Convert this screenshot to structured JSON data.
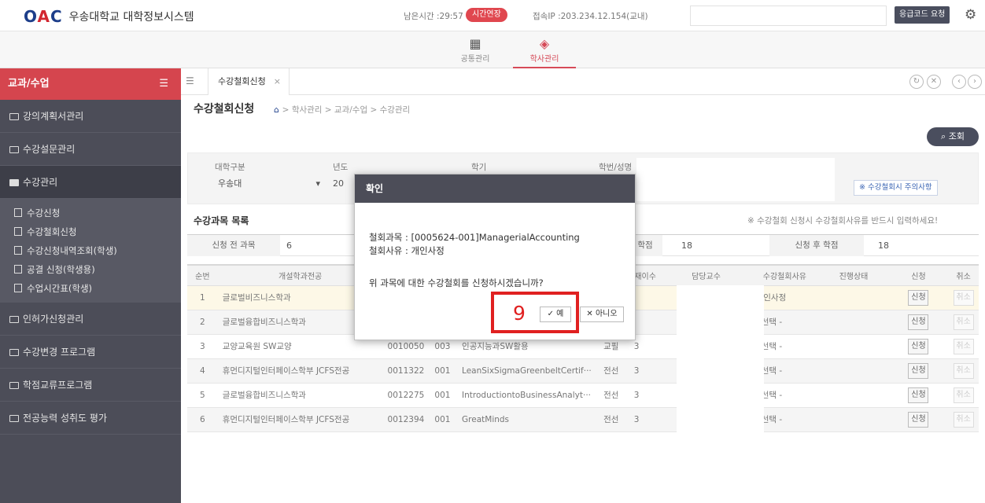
{
  "header": {
    "logo_mark": "OAC",
    "logo_text": "우송대학교 대학정보시스템",
    "remaining_time": "남은시간 :29:57",
    "extend_label": "시간연장",
    "ip_info": "접속IP :203.234.12.154(교내)",
    "emergency_code_label": "응급코드 요청",
    "settings_icon": "gear-icon"
  },
  "modules": [
    {
      "label": "공통관리",
      "icon": "grid-icon"
    },
    {
      "label": "학사관리",
      "icon": "graduation-cap-icon"
    }
  ],
  "sidebar": {
    "title": "교과/수업",
    "items": [
      {
        "label": "강의계획서관리"
      },
      {
        "label": "수강설문관리"
      },
      {
        "label": "수강관리"
      }
    ],
    "subitems": [
      {
        "label": "수강신청"
      },
      {
        "label": "수강철회신청"
      },
      {
        "label": "수강신청내역조회(학생)"
      },
      {
        "label": "공결 신청(학생용)"
      },
      {
        "label": "수업시간표(학생)"
      }
    ],
    "more_items": [
      {
        "label": "인허가신청관리"
      },
      {
        "label": "수강변경 프로그램"
      },
      {
        "label": "학점교류프로그램"
      },
      {
        "label": "전공능력 성취도 평가"
      }
    ]
  },
  "tabs": {
    "active_tab": "수강철회신청"
  },
  "page": {
    "title": "수강철회신청",
    "breadcrumb": "학사관리 > 교과/수업 > 수강관리",
    "search_label": "조회"
  },
  "filter": {
    "univ_label": "대학구분",
    "univ_value": "우송대",
    "year_label": "년도",
    "year_value": "20",
    "semester_label": "학기",
    "student_label": "학번/성명",
    "notice_label": "※ 수강철회시 주의사항"
  },
  "list": {
    "title": "수강과목 목록",
    "note": "※ 수강철회 신청시 수강철회사유를 반드시 입력하세요!",
    "summary": {
      "before_label": "신청 전 과목",
      "before_value": "6",
      "credit_label": "학점",
      "credit_value": "18",
      "after_label": "신청 후 학점",
      "after_value": "18"
    },
    "columns": [
      "순번",
      "개설학과전공",
      "",
      "",
      "",
      "",
      "재이수",
      "담당교수",
      "수강철회사유",
      "진행상태",
      "신청",
      "취소"
    ],
    "rows": [
      {
        "no": "1",
        "dept": "글로벌비즈니스학과",
        "code": "",
        "sec": "",
        "name": "",
        "type": "",
        "credit": "",
        "reason": "개인사정",
        "apply": "신청",
        "cancel": "취소"
      },
      {
        "no": "2",
        "dept": "글로벌융합비즈니스학과",
        "code": "",
        "sec": "",
        "name": "",
        "type": "",
        "credit": "",
        "reason": "- 선택 -",
        "apply": "신청",
        "cancel": "취소"
      },
      {
        "no": "3",
        "dept": "교양교육원 SW교양",
        "code": "0010050",
        "sec": "003",
        "name": "인공지능과SW활용",
        "type": "교필",
        "credit": "3",
        "reason": "- 선택 -",
        "apply": "신청",
        "cancel": "취소"
      },
      {
        "no": "4",
        "dept": "휴먼디지털인터페이스학부 JCFS전공",
        "code": "0011322",
        "sec": "001",
        "name": "LeanSixSigmaGreenbeltCertif···",
        "type": "전선",
        "credit": "3",
        "reason": "- 선택 -",
        "apply": "신청",
        "cancel": "취소"
      },
      {
        "no": "5",
        "dept": "글로벌융합비즈니스학과",
        "code": "0012275",
        "sec": "001",
        "name": "IntroductiontoBusinessAnalyt···",
        "type": "전선",
        "credit": "3",
        "reason": "- 선택 -",
        "apply": "신청",
        "cancel": "취소"
      },
      {
        "no": "6",
        "dept": "휴먼디지털인터페이스학부 JCFS전공",
        "code": "0012394",
        "sec": "001",
        "name": "GreatMinds",
        "type": "전선",
        "credit": "3",
        "reason": "- 선택 -",
        "apply": "신청",
        "cancel": "취소"
      }
    ]
  },
  "modal": {
    "title": "확인",
    "course_line": "철회과목 : [0005624-001]ManagerialAccounting",
    "reason_line": "철회사유 : 개인사정",
    "question": "위 과목에 대한 수강철회를 신청하시겠습니까?",
    "yes_label": "✓ 예",
    "no_label": "✕ 아니오"
  },
  "annotation": {
    "step_number": "9",
    "color": "#e02020"
  }
}
